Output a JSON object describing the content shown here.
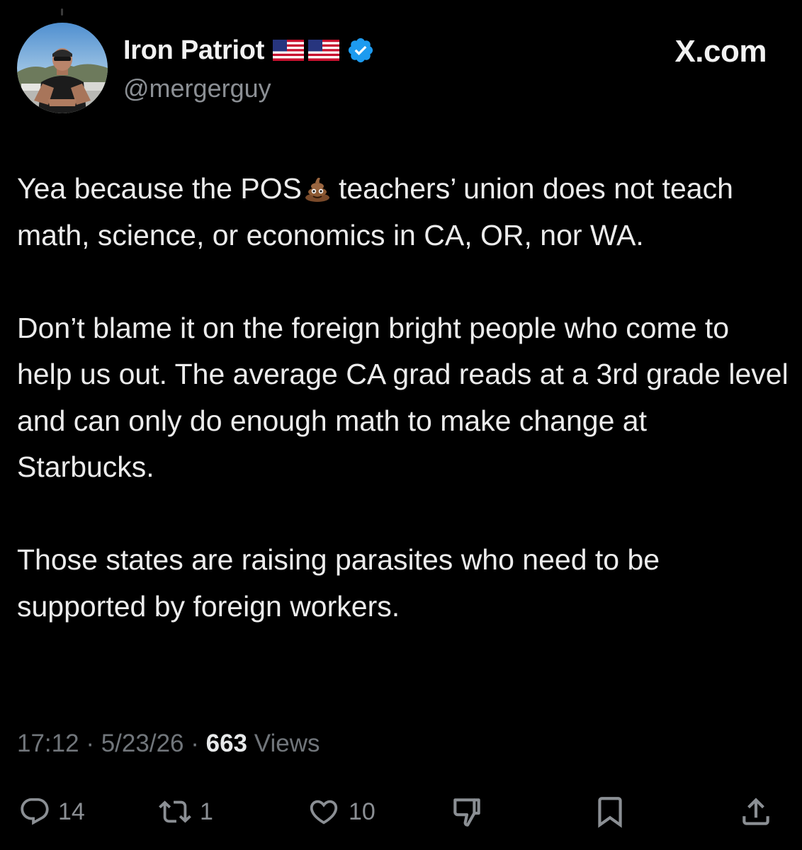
{
  "site": {
    "label": "X.com"
  },
  "user": {
    "name": "Iron Patriot",
    "handle": "@mergerguy",
    "flags": "🇺🇸🇺🇸",
    "verified": true,
    "badge_color": "#1d9bf0"
  },
  "post": {
    "paragraphs": [
      {
        "before": "Yea because the POS",
        "emoji": "💩",
        "after": "teachers’ union does not teach math, science, or economics in CA, OR, nor WA."
      },
      {
        "text": "Don’t blame it on the foreign bright people who come to help us out.  The average CA grad reads at a 3rd grade level and can only do enough math to make change at Starbucks."
      },
      {
        "text": "Those states are raising parasites who need to be supported by foreign workers."
      }
    ]
  },
  "meta": {
    "time": "17:12",
    "date": "5/23/26",
    "views_count": "663",
    "views_label": "Views",
    "separator": "·"
  },
  "actions": {
    "replies": "14",
    "reposts": "1",
    "likes": "10"
  },
  "colors": {
    "background": "#000000",
    "text": "#e7e9ea",
    "muted": "#71767b",
    "icon": "#8b8f94"
  }
}
